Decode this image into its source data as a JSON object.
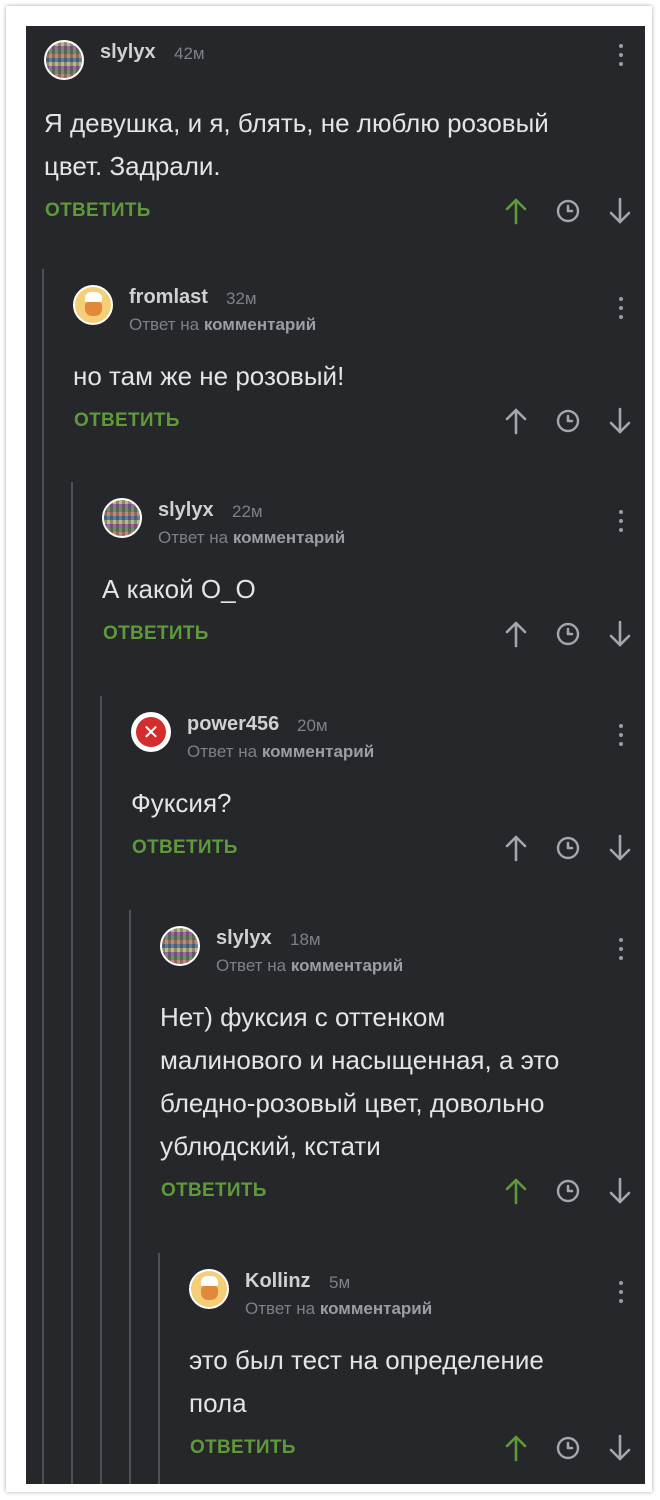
{
  "labels": {
    "reply_button": "ОТВЕТИТЬ",
    "reply_to_prefix": "Ответ на",
    "reply_to_target": "комментарий"
  },
  "colors": {
    "background": "#25272b",
    "accent_green": "#5f9a3a",
    "muted_text": "#7d8086"
  },
  "comments": [
    {
      "username": "slylyx",
      "time": "42м",
      "avatar": "mosaic",
      "is_reply": false,
      "body": [
        "Я девушка, и я, блять, не люблю розовый",
        "цвет. Задрали."
      ],
      "upvoted": true
    },
    {
      "username": "fromlast",
      "time": "32м",
      "avatar": "chef",
      "is_reply": true,
      "body": [
        "но там же не розовый!"
      ],
      "upvoted": false
    },
    {
      "username": "slylyx",
      "time": "22м",
      "avatar": "mosaic",
      "is_reply": true,
      "body": [
        "А какой О_О"
      ],
      "upvoted": false
    },
    {
      "username": "power456",
      "time": "20м",
      "avatar": "error",
      "is_reply": true,
      "body": [
        "Фуксия?"
      ],
      "upvoted": false
    },
    {
      "username": "slylyx",
      "time": "18м",
      "avatar": "mosaic",
      "is_reply": true,
      "body": [
        "Нет) фуксия с оттенком",
        "малинового и насыщенная, а это",
        "бледно-розовый цвет, довольно",
        "ублюдский, кстати"
      ],
      "upvoted": true
    },
    {
      "username": "Kollinz",
      "time": "5м",
      "avatar": "chef",
      "is_reply": true,
      "body": [
        "это был тест на определение",
        "пола"
      ],
      "upvoted": true
    }
  ]
}
